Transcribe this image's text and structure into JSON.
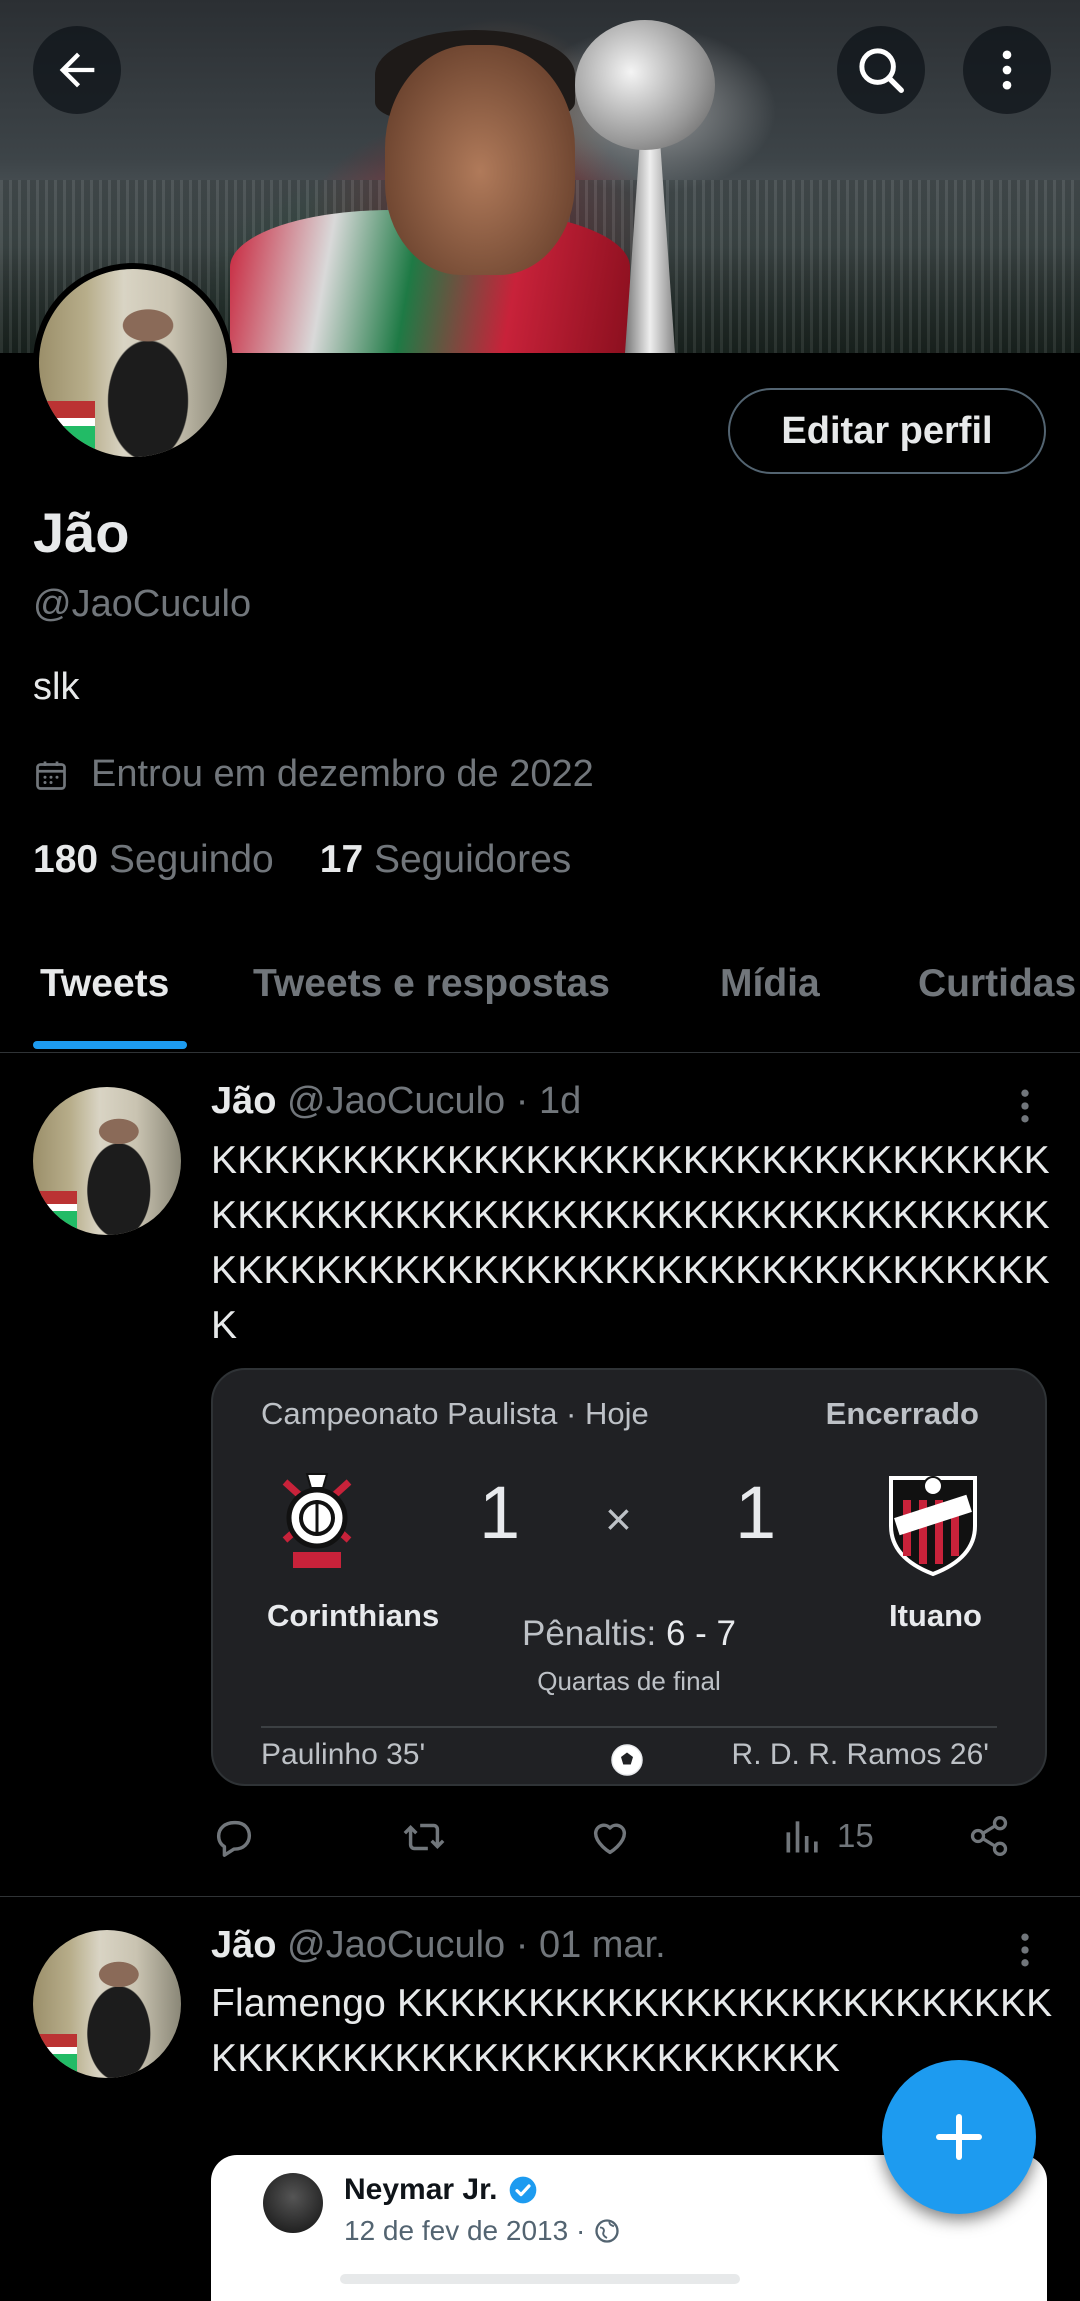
{
  "header": {
    "back_icon": "arrow-left-icon",
    "search_icon": "search-icon",
    "more_icon": "more-vertical-icon"
  },
  "profile": {
    "name": "Jão",
    "handle": "@JaoCuculo",
    "bio": "slk",
    "joined": "Entrou em dezembro de 2022",
    "following_count": "180",
    "following_label": "Seguindo",
    "followers_count": "17",
    "followers_label": "Seguidores",
    "edit_button": "Editar perfil"
  },
  "tabs": [
    {
      "label": "Tweets",
      "active": true
    },
    {
      "label": "Tweets e respostas",
      "active": false
    },
    {
      "label": "Mídia",
      "active": false
    },
    {
      "label": "Curtidas",
      "active": false
    }
  ],
  "tweets": [
    {
      "name": "Jão",
      "meta": "@JaoCuculo · 1d",
      "text": "KKKKKKKKKKKKKKKKKKKKKKKKKKKKKKKKKKKKKKKKKKKKKKKKKKKKKKKKKKKKKKKKKKKKKKKKKKKKKKKKKKKKKKKKKKKKKKKKK",
      "match": {
        "competition": "Campeonato Paulista · Hoje",
        "status": "Encerrado",
        "home_team": "Corinthians",
        "away_team": "Ituano",
        "home_score": "1",
        "away_score": "1",
        "separator": "×",
        "penalties_label": "Pênaltis:",
        "penalties_score": "6 - 7",
        "stage": "Quartas de final",
        "home_scorer": "Paulinho 35'",
        "away_scorer": "R. D. R. Ramos 26'"
      },
      "views": "15"
    },
    {
      "name": "Jão",
      "meta": "@JaoCuculo · 01 mar.",
      "text": "Flamengo KKKKKKKKKKKKKKKKKKKKKKKKKKKKKKKKKKKKKKKKKKKKKKKKK",
      "embed": {
        "name": "Neymar Jr.",
        "date": "12 de fev de 2013 ·"
      }
    }
  ],
  "colors": {
    "accent": "#1d9bf0",
    "background": "#000000",
    "muted": "#71767b",
    "text": "#e7e9ea"
  }
}
